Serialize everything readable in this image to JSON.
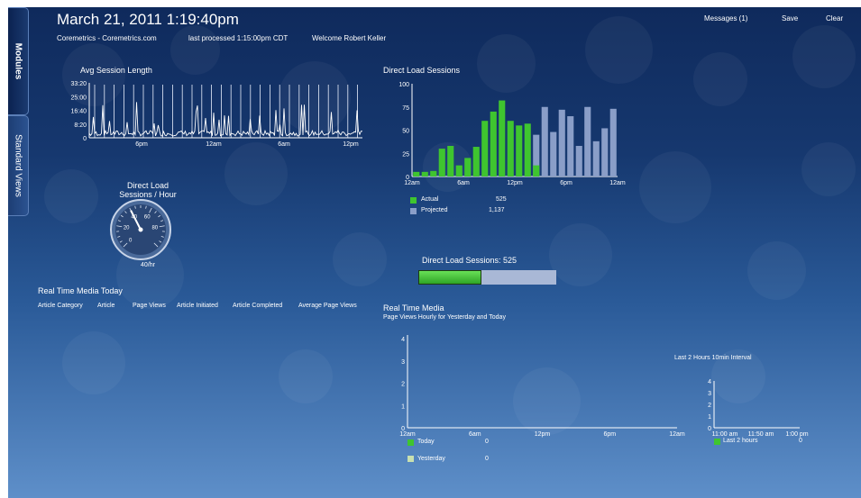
{
  "header": {
    "datetime": "March 21, 2011 1:19:40pm",
    "site": "Coremetrics - Coremetrics.com",
    "last_processed": "last processed 1:15:00pm CDT",
    "welcome": "Welcome Robert Keller"
  },
  "topbar": {
    "messages": "Messages (1)",
    "save": "Save",
    "clear": "Clear"
  },
  "side_tabs": {
    "modules": "Modules",
    "standard_views": "Standard Views"
  },
  "colors": {
    "actual": "#3fc52f",
    "projected": "#8a9ec8",
    "today": "#3fc52f",
    "yesterday": "#c8e0b0"
  },
  "avg_session": {
    "title": "Avg Session Length",
    "y_ticks": [
      "33:20",
      "25:00",
      "16:40",
      "8:20",
      "0"
    ],
    "x_ticks": [
      "6pm",
      "12am",
      "6am",
      "12pm"
    ]
  },
  "gauge": {
    "title_line1": "Direct Load",
    "title_line2": "Sessions / Hour",
    "ticks": [
      "0",
      "20",
      "40",
      "60",
      "80"
    ],
    "value_label": "40/hr",
    "value": 40,
    "max": 100
  },
  "direct_load_chart": {
    "title": "Direct Load Sessions",
    "legend": [
      {
        "name": "Actual",
        "value": "525"
      },
      {
        "name": "Projected",
        "value": "1,137"
      }
    ]
  },
  "chart_data": {
    "type": "bar",
    "title": "Direct Load Sessions",
    "y_ticks": [
      "100",
      "75",
      "50",
      "25",
      "0"
    ],
    "x_ticks": [
      "12am",
      "6am",
      "12pm",
      "6pm",
      "12am"
    ],
    "ylim": [
      0,
      100
    ],
    "series": [
      {
        "name": "Actual",
        "values": [
          5,
          5,
          6,
          30,
          33,
          12,
          20,
          32,
          60,
          70,
          82,
          60,
          55,
          57,
          12
        ]
      },
      {
        "name": "Projected",
        "values": [
          0,
          0,
          0,
          0,
          0,
          0,
          0,
          0,
          0,
          0,
          0,
          0,
          0,
          0,
          45,
          75,
          48,
          72,
          65,
          33,
          75,
          38,
          52,
          73
        ]
      }
    ]
  },
  "sessions_bar": {
    "label": "Direct Load Sessions: 525",
    "fraction": 0.46
  },
  "media_today": {
    "title": "Real Time Media Today",
    "columns": [
      "Article Category",
      "Article",
      "Page Views",
      "Article Initiated",
      "Article Completed",
      "Average Page Views"
    ]
  },
  "realtime_media": {
    "title": "Real Time Media",
    "subtitle": "Page Views Hourly for Yesterday and Today",
    "y_ticks": [
      "4",
      "3",
      "2",
      "1",
      "0"
    ],
    "x_ticks": [
      "12am",
      "6am",
      "12pm",
      "6pm",
      "12am"
    ],
    "legend": [
      {
        "name": "Today",
        "value": "0"
      },
      {
        "name": "Yesterday",
        "value": "0"
      }
    ],
    "last2": {
      "title": "Last 2 Hours 10min Interval",
      "y_ticks": [
        "4",
        "3",
        "2",
        "1",
        "0"
      ],
      "x_ticks": [
        "11:00 am",
        "11:50 am",
        "1:00 pm"
      ],
      "legend": {
        "name": "Last 2 hours",
        "value": "0"
      }
    }
  }
}
